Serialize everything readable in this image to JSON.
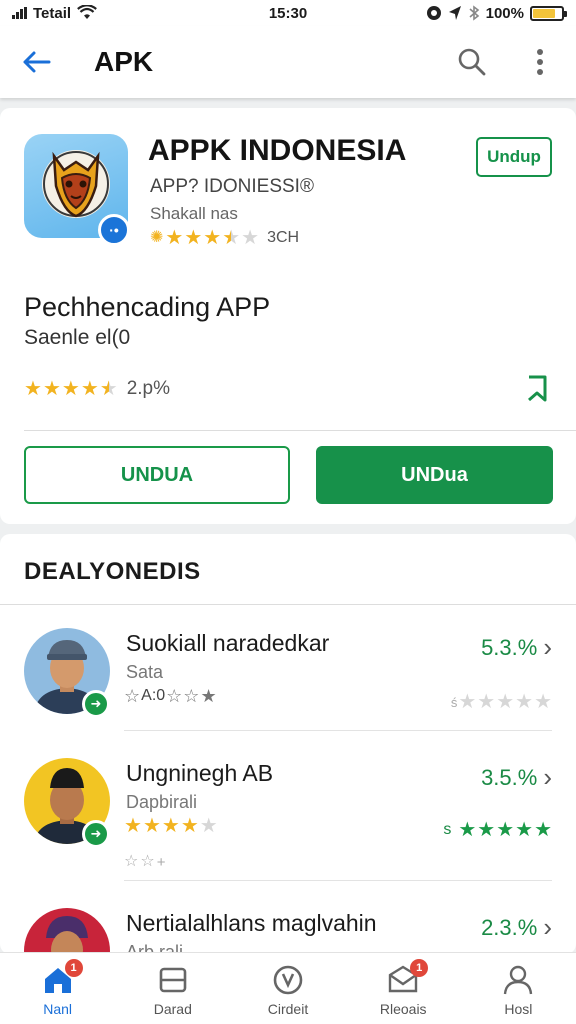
{
  "status_bar": {
    "carrier": "Tetail",
    "time": "15:30",
    "battery": "100%",
    "battery_level": 0.8
  },
  "app_bar": {
    "title": "APK",
    "back_icon": "arrow-left-icon",
    "search_icon": "search-icon",
    "menu_icon": "more-vertical-icon"
  },
  "app": {
    "title": "APPK INDONESIA",
    "install_small_label": "Undup",
    "subtitle": "APP? IDONIESSI®",
    "developer": "Shakall nas",
    "rating_text": "3CH",
    "stars": [
      1,
      1,
      1,
      0.5,
      0
    ]
  },
  "section": {
    "title": "Pechhencading APP",
    "subtitle": "Saenle el(0",
    "rating_text": "2.p%",
    "stars": [
      1,
      1,
      1,
      1,
      0.5
    ]
  },
  "buttons": {
    "outline_label": "UNDUA",
    "filled_label": "UNDua"
  },
  "list": {
    "header": "DEALYONEDIS",
    "items": [
      {
        "title": "Suokiall naradedkar",
        "subtitle": "Sata",
        "stars_text": "A:0",
        "value": "5.3.%",
        "arrow": "›",
        "avatar_bg": "#5aa0d8"
      },
      {
        "title": "Ungninegh AB",
        "subtitle": "Dapbirali",
        "stars_text": "",
        "value": "3.5.%",
        "arrow": "›",
        "right_label": "s",
        "avatar_bg": "#f2c523"
      },
      {
        "title": "Nertialalhlans maglvahin",
        "subtitle": "Arb rali",
        "stars_text": "",
        "value": "2.3.%",
        "arrow": "›",
        "avatar_bg": "#c8243a"
      }
    ]
  },
  "bottom_nav": [
    {
      "label": "Nanl",
      "icon": "home-icon",
      "badge": "1",
      "active": true
    },
    {
      "label": "Darad",
      "icon": "list-icon",
      "badge": "",
      "active": false
    },
    {
      "label": "Cirdeit",
      "icon": "circle-icon",
      "badge": "",
      "active": false
    },
    {
      "label": "Rleoais",
      "icon": "mail-icon",
      "badge": "1",
      "active": false
    },
    {
      "label": "Hosl",
      "icon": "person-icon",
      "badge": "",
      "active": false
    }
  ],
  "colors": {
    "accent_green": "#17914a",
    "star_yellow": "#f2b320",
    "link_blue": "#1a6fd8",
    "badge_red": "#e0473a"
  }
}
